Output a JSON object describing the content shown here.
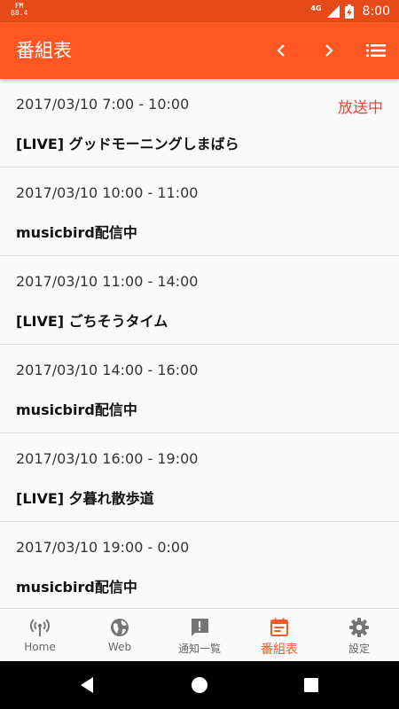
{
  "status": {
    "fm_top": "FM",
    "fm_bottom": "88.4",
    "network": "4G",
    "time": "8:00"
  },
  "app_bar": {
    "title": "番組表",
    "icons": [
      "chevron-left-icon",
      "chevron-right-icon",
      "list-icon"
    ]
  },
  "schedule": [
    {
      "time": "2017/03/10 7:00 - 10:00",
      "title": "[LIVE] グッドモーニングしまばら",
      "badge": "放送中"
    },
    {
      "time": "2017/03/10 10:00 - 11:00",
      "title": "musicbird配信中",
      "badge": ""
    },
    {
      "time": "2017/03/10 11:00 - 14:00",
      "title": "[LIVE] ごちそうタイム",
      "badge": ""
    },
    {
      "time": "2017/03/10 14:00 - 16:00",
      "title": "musicbird配信中",
      "badge": ""
    },
    {
      "time": "2017/03/10 16:00 - 19:00",
      "title": "[LIVE] 夕暮れ散歩道",
      "badge": ""
    },
    {
      "time": "2017/03/10 19:00 - 0:00",
      "title": "musicbird配信中",
      "badge": ""
    }
  ],
  "bottom_nav": [
    {
      "label": "Home",
      "icon": "radio-tower-icon",
      "active": false
    },
    {
      "label": "Web",
      "icon": "globe-icon",
      "active": false
    },
    {
      "label": "通知一覧",
      "icon": "notification-icon",
      "active": false
    },
    {
      "label": "番組表",
      "icon": "calendar-icon",
      "active": true
    },
    {
      "label": "設定",
      "icon": "gear-icon",
      "active": false
    }
  ],
  "colors": {
    "status_bar": "#e64a19",
    "app_bar": "#ff5722",
    "accent": "#ff5722",
    "on_air": "#f44336"
  }
}
